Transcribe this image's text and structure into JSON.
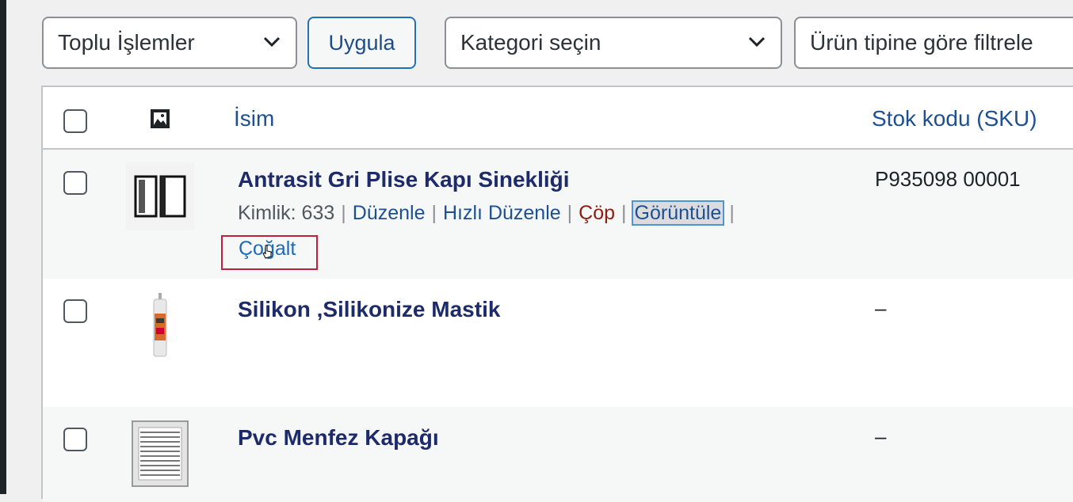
{
  "toolbar": {
    "bulk_actions": "Toplu İşlemler",
    "apply": "Uygula",
    "category": "Kategori seçin",
    "product_type": "Ürün tipine göre filtrele"
  },
  "table": {
    "headers": {
      "name": "İsim",
      "sku": "Stok kodu (SKU)"
    },
    "rows": [
      {
        "name": "Antrasit Gri Plise Kapı Sinekliği",
        "sku": "P935098 00001",
        "thumb": "door-screen-image"
      },
      {
        "name": "Silikon ,Silikonize Mastik",
        "sku": "–",
        "thumb": "sealant-tube-image"
      },
      {
        "name": "Pvc Menfez Kapağı",
        "sku": "–",
        "thumb": "vent-cover-image"
      }
    ],
    "row_actions": {
      "id_label": "Kimlik: 633",
      "sep": "|",
      "edit": "Düzenle",
      "quick_edit": "Hızlı Düzenle",
      "trash": "Çöp",
      "view": "Görüntüle",
      "duplicate": "Çoğalt"
    }
  },
  "colors": {
    "link": "#1e4f91",
    "trash": "#8a1f11",
    "highlight": "#c41e3a"
  }
}
